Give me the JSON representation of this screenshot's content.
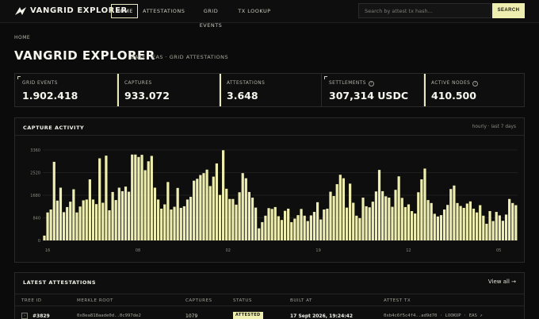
{
  "nav": {
    "brand": "VANGRID EXPLORER",
    "tabs": [
      {
        "label": "HOME",
        "active": true
      },
      {
        "label": "ATTESTATIONS",
        "active": false
      },
      {
        "label": "GRID EVENTS",
        "active": false
      },
      {
        "label": "TX LOOKUP",
        "active": false
      }
    ],
    "search_placeholder": "Search by attest tx hash...",
    "search_button": "SEARCH",
    "logo_icon": "vangrid-logo-icon"
  },
  "breadcrumb": "HOME",
  "page": {
    "title": "VANGRID EXPLORER",
    "subtitle": "BASE · EAS · GRID ATTESTATIONS"
  },
  "stats": [
    {
      "label": "GRID EVENTS",
      "value": "1.902.418",
      "help": false
    },
    {
      "label": "CAPTURES",
      "value": "933.072",
      "help": false
    },
    {
      "label": "ATTESTATIONS",
      "value": "3.648",
      "help": false
    },
    {
      "label": "SETTLEMENTS",
      "value": "307,314 USDC",
      "help": true
    },
    {
      "label": "ACTIVE NODES",
      "value": "410.500",
      "help": true
    }
  ],
  "capture_activity": {
    "title": "CAPTURE ACTIVITY",
    "note": "hourly · last 7 days"
  },
  "chart_data": {
    "type": "bar",
    "y_ticks": [
      "0",
      "840",
      "1680",
      "2520",
      "3360"
    ],
    "ylim": [
      0,
      3360
    ],
    "x_ticks": [
      "16",
      "08",
      "02",
      "19",
      "12",
      "05"
    ],
    "bar_color": "#eeeeb0",
    "grid": true,
    "values": [
      180,
      1040,
      1150,
      2920,
      1480,
      1960,
      1050,
      1240,
      1440,
      1900,
      1040,
      1260,
      1490,
      1520,
      2270,
      1520,
      1350,
      3050,
      1400,
      3150,
      1120,
      1800,
      1500,
      1960,
      1830,
      2000,
      1810,
      3190,
      3190,
      3100,
      3180,
      2610,
      2940,
      3140,
      1960,
      1520,
      1180,
      1340,
      2170,
      1150,
      1250,
      1950,
      1210,
      1270,
      1520,
      1620,
      2220,
      2290,
      2430,
      2500,
      2630,
      2020,
      2370,
      2860,
      1690,
      3350,
      1920,
      1540,
      1540,
      1330,
      1790,
      2500,
      2310,
      1800,
      1590,
      1220,
      450,
      680,
      920,
      1200,
      1170,
      1240,
      900,
      760,
      1100,
      1180,
      680,
      810,
      940,
      1170,
      920,
      720,
      930,
      1060,
      1420,
      780,
      1150,
      1180,
      1810,
      1650,
      2090,
      2440,
      2310,
      1220,
      2110,
      1400,
      920,
      830,
      1590,
      1270,
      1230,
      1440,
      1820,
      2620,
      1830,
      1640,
      1590,
      1250,
      1880,
      2380,
      1580,
      1240,
      1340,
      1090,
      1000,
      1790,
      2270,
      2670,
      1500,
      1390,
      990,
      890,
      940,
      1150,
      1320,
      1910,
      2040,
      1390,
      1280,
      1210,
      1370,
      1450,
      1180,
      1040,
      1310,
      920,
      620,
      1090,
      720,
      1060,
      930,
      730,
      960,
      1540,
      1390,
      1310
    ]
  },
  "latest": {
    "title": "LATEST ATTESTATIONS",
    "view_all": "View all →",
    "columns": [
      "TREE ID",
      "MERKLE ROOT",
      "CAPTURES",
      "STATUS",
      "BUILT AT",
      "ATTEST TX"
    ],
    "rows": [
      {
        "tree_id": "#3829",
        "merkle_root": "0x8ea818aade0d..0c997de2",
        "captures": "1079",
        "status": "ATTESTED",
        "built_at": "17 Sept 2026, 19:24:42",
        "attest_tx": "0xb4c6f5c4f4..ad9d70 · LOOKUP · EAS ↗"
      }
    ]
  }
}
